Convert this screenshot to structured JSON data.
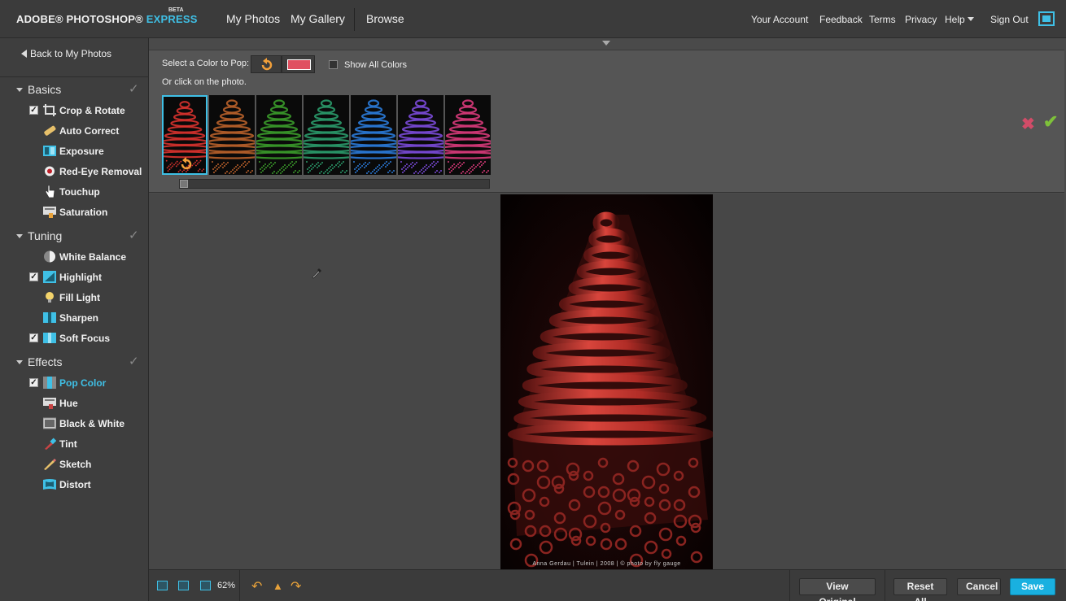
{
  "header": {
    "brand": "ADOBE® PHOTOSHOP®",
    "brand_express": "EXPRESS",
    "beta": "BETA",
    "nav_main": [
      "My Photos",
      "My Gallery",
      "Browse"
    ],
    "nav_right": [
      "Your Account",
      "Feedback",
      "Terms",
      "Privacy",
      "Help",
      "Sign Out"
    ],
    "fullscreen_icon": "fullscreen-icon"
  },
  "sidebar": {
    "back_label": "Back to My Photos",
    "sections": [
      {
        "title": "Basics",
        "tools": [
          {
            "label": "Crop & Rotate",
            "checked": true,
            "icon": "crop-icon"
          },
          {
            "label": "Auto Correct",
            "checked": false,
            "icon": "bandage-icon"
          },
          {
            "label": "Exposure",
            "checked": false,
            "icon": "exposure-icon"
          },
          {
            "label": "Red-Eye Removal",
            "checked": false,
            "icon": "eye-icon"
          },
          {
            "label": "Touchup",
            "checked": false,
            "icon": "hand-icon"
          },
          {
            "label": "Saturation",
            "checked": false,
            "icon": "saturation-icon"
          }
        ]
      },
      {
        "title": "Tuning",
        "tools": [
          {
            "label": "White Balance",
            "checked": false,
            "icon": "white-balance-icon"
          },
          {
            "label": "Highlight",
            "checked": true,
            "icon": "highlight-icon"
          },
          {
            "label": "Fill Light",
            "checked": false,
            "icon": "bulb-icon"
          },
          {
            "label": "Sharpen",
            "checked": false,
            "icon": "sharpen-icon"
          },
          {
            "label": "Soft Focus",
            "checked": true,
            "icon": "soft-focus-icon"
          }
        ]
      },
      {
        "title": "Effects",
        "tools": [
          {
            "label": "Pop Color",
            "checked": true,
            "icon": "pop-color-icon",
            "active": true
          },
          {
            "label": "Hue",
            "checked": false,
            "icon": "hue-icon"
          },
          {
            "label": "Black & White",
            "checked": false,
            "icon": "black-white-icon"
          },
          {
            "label": "Tint",
            "checked": false,
            "icon": "tint-icon"
          },
          {
            "label": "Sketch",
            "checked": false,
            "icon": "sketch-icon"
          },
          {
            "label": "Distort",
            "checked": false,
            "icon": "distort-icon"
          }
        ]
      }
    ]
  },
  "options": {
    "select_label": "Select a Color to Pop:",
    "show_all_label": "Show All Colors",
    "show_all_checked": false,
    "or_click": "Or click on the photo.",
    "swatch_color": "#e05060",
    "thumb_colors": [
      "#d8322e",
      "#b8602a",
      "#3a9a2a",
      "#2a9a6a",
      "#2a7ad8",
      "#7a4ad8",
      "#d83a7a"
    ],
    "selected_thumb": 0
  },
  "photo": {
    "watermark": "Anna Gerdau | Tulein | 2008 | © photo by fly gauge"
  },
  "bottom": {
    "zoom": "62%",
    "view_original": "View Original",
    "reset_all": "Reset All",
    "cancel": "Cancel",
    "save": "Save"
  },
  "colors": {
    "accent": "#3fc0e6",
    "save": "#19b0e0",
    "cancel_x": "#d24c68",
    "accept_check": "#7ec13a"
  }
}
